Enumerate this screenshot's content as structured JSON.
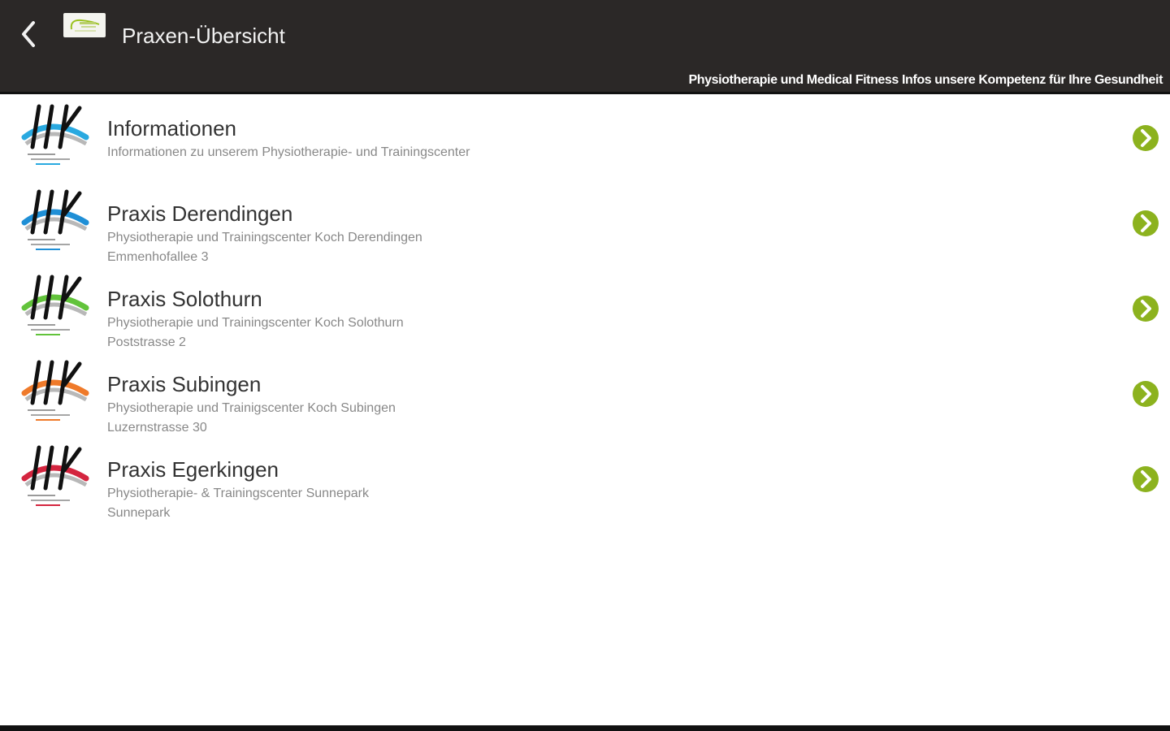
{
  "header": {
    "title": "Praxen-Übersicht",
    "tagline": "Physiotherapie und Medical Fitness Infos unsere Kompetenz für Ihre Gesundheit",
    "back_icon": "chevron-left-icon",
    "background": "#2b2827"
  },
  "items": [
    {
      "title": "Informationen",
      "subtitle": "Informationen zu unserem Physiotherapie- und Trainingscenter",
      "address": "",
      "accent": "#29a9e0"
    },
    {
      "title": "Praxis Derendingen",
      "subtitle": "Physiotherapie und Trainingscenter Koch Derendingen",
      "address": "Emmenhofallee 3",
      "accent": "#1f8fd6"
    },
    {
      "title": "Praxis Solothurn",
      "subtitle": "Physiotherapie und Trainingscenter Koch Solothurn",
      "address": "Poststrasse 2",
      "accent": "#62c33b"
    },
    {
      "title": "Praxis Subingen",
      "subtitle": "Physiotherapie und Trainigscenter Koch Subingen",
      "address": "Luzernstrasse 30",
      "accent": "#ef7a2a"
    },
    {
      "title": "Praxis Egerkingen",
      "subtitle": "Physiotherapie- & Trainingscenter Sunnepark",
      "address": "Sunnepark",
      "accent": "#d4253f"
    }
  ],
  "colors": {
    "chevron": "#8cb21e",
    "title_text": "#333333",
    "sub_text": "#888888"
  }
}
